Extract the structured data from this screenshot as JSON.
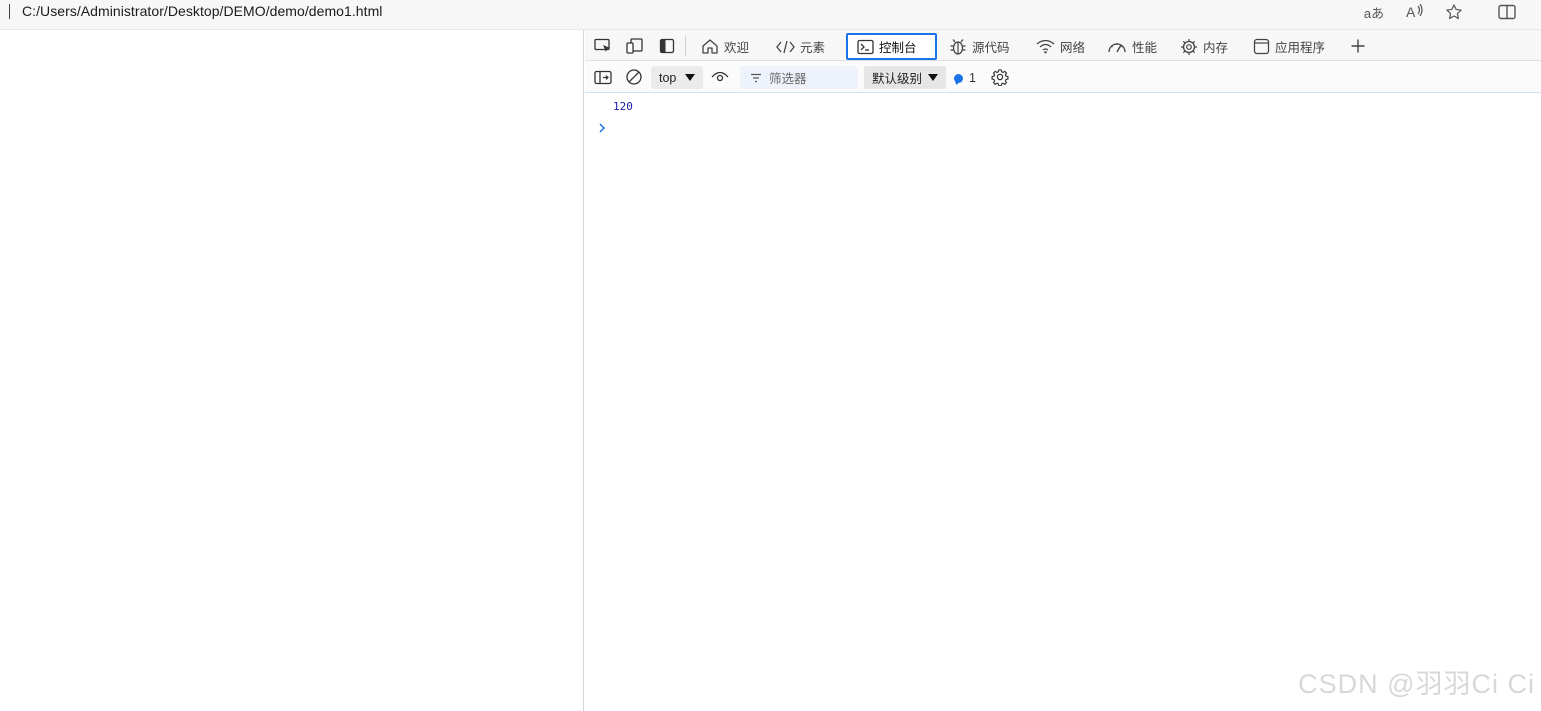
{
  "browser": {
    "url": "C:/Users/Administrator/Desktop/DEMO/demo/demo1.html",
    "buttons": [
      {
        "icon": "read-aloud-translate-icon"
      },
      {
        "icon": "read-aloud-icon"
      },
      {
        "icon": "favorite-star-icon"
      },
      {
        "icon": "split-screen-icon"
      }
    ]
  },
  "devtools": {
    "tabs": [
      {
        "label": "欢迎",
        "icon": "home-icon"
      },
      {
        "label": "元素",
        "icon": "code-icon"
      },
      {
        "label": "控制台",
        "icon": "console-icon",
        "active": true
      },
      {
        "label": "源代码",
        "icon": "bug-icon"
      },
      {
        "label": "网络",
        "icon": "wifi-icon"
      },
      {
        "label": "性能",
        "icon": "gauge-icon"
      },
      {
        "label": "内存",
        "icon": "chip-icon"
      },
      {
        "label": "应用程序",
        "icon": "app-icon"
      }
    ],
    "toolbar": {
      "context": "top",
      "filter_placeholder": "筛选器",
      "level": "默认级别",
      "message_count": "1"
    },
    "console": {
      "lines": [
        "120"
      ],
      "prompt_icon": "chevron-right-icon"
    }
  },
  "watermark": "CSDN @羽羽Ci Ci",
  "colors": {
    "accent": "#1a73e8",
    "log_text": "#1a1aa6"
  }
}
